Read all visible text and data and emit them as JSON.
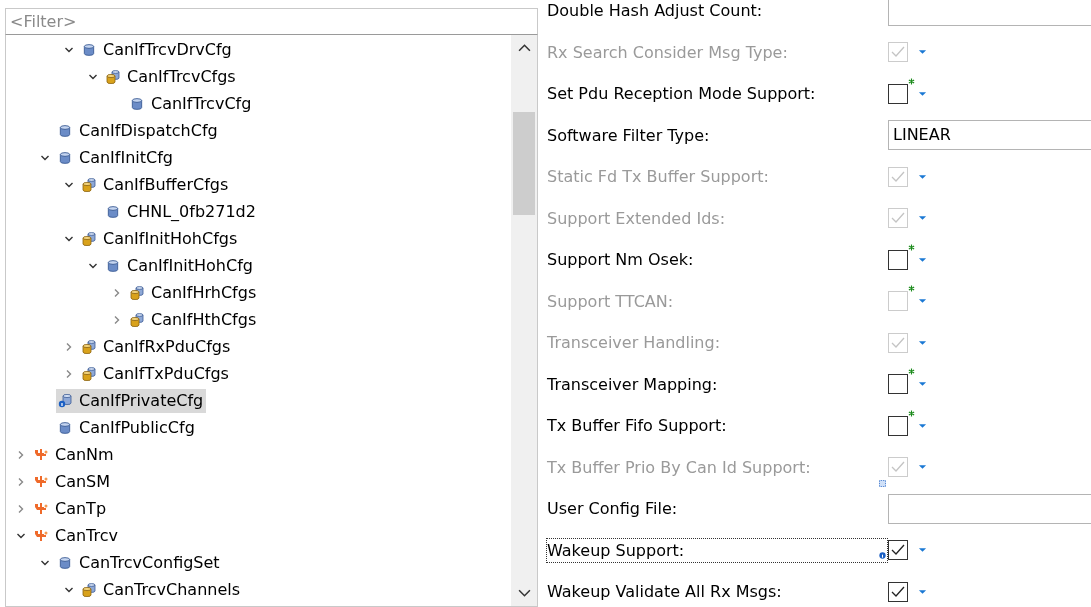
{
  "filter": {
    "placeholder": "<Filter>"
  },
  "tree": [
    {
      "children": [
        {
          "children": [
            {
              "label": "CanIfTrcvDrvCfg",
              "kind": "element",
              "expanded": true,
              "selected": false,
              "children": [
                {
                  "label": "CanIfTrcvCfgs",
                  "kind": "container",
                  "expanded": true,
                  "selected": false,
                  "children": [
                    {
                      "label": "CanIfTrcvCfg",
                      "kind": "element",
                      "selected": false
                    }
                  ]
                }
              ]
            }
          ]
        },
        {
          "label": "CanIfDispatchCfg",
          "kind": "element",
          "selected": false
        },
        {
          "label": "CanIfInitCfg",
          "kind": "element",
          "expanded": true,
          "selected": false,
          "children": [
            {
              "label": "CanIfBufferCfgs",
              "kind": "container",
              "expanded": true,
              "selected": false,
              "children": [
                {
                  "label": "CHNL_0fb271d2",
                  "kind": "element",
                  "selected": false
                }
              ]
            },
            {
              "label": "CanIfInitHohCfgs",
              "kind": "container",
              "expanded": true,
              "selected": false,
              "children": [
                {
                  "label": "CanIfInitHohCfg",
                  "kind": "element",
                  "expanded": true,
                  "selected": false,
                  "children": [
                    {
                      "label": "CanIfHrhCfgs",
                      "kind": "container",
                      "expanded": false,
                      "selected": false
                    },
                    {
                      "label": "CanIfHthCfgs",
                      "kind": "container",
                      "expanded": false,
                      "selected": false
                    }
                  ]
                }
              ]
            },
            {
              "label": "CanIfRxPduCfgs",
              "kind": "container",
              "expanded": false,
              "selected": false
            },
            {
              "label": "CanIfTxPduCfgs",
              "kind": "container",
              "expanded": false,
              "selected": false
            }
          ]
        },
        {
          "label": "CanIfPrivateCfg",
          "kind": "private",
          "selected": true
        },
        {
          "label": "CanIfPublicCfg",
          "kind": "element",
          "selected": false
        }
      ]
    },
    {
      "label": "CanNm",
      "kind": "module",
      "expanded": false,
      "selected": false
    },
    {
      "label": "CanSM",
      "kind": "module",
      "expanded": false,
      "selected": false
    },
    {
      "label": "CanTp",
      "kind": "module",
      "expanded": false,
      "selected": false
    },
    {
      "label": "CanTrcv",
      "kind": "module",
      "expanded": true,
      "selected": false,
      "children": [
        {
          "label": "CanTrcvConfigSet",
          "kind": "element",
          "expanded": true,
          "selected": false,
          "children": [
            {
              "label": "CanTrcvChannels",
              "kind": "container",
              "expanded": true,
              "selected": false
            }
          ]
        }
      ]
    }
  ],
  "properties": [
    {
      "label": "Double Hash Adjust Count:",
      "kind": "text",
      "disabled": false
    },
    {
      "label": "Rx Search Consider Msg Type:",
      "kind": "checkbox",
      "checked": true,
      "disabled": true,
      "modified": false
    },
    {
      "label": "Set Pdu Reception Mode Support:",
      "kind": "checkbox",
      "checked": false,
      "disabled": false,
      "modified": true
    },
    {
      "label": "Software Filter Type:",
      "kind": "text",
      "value": "LINEAR",
      "disabled": false
    },
    {
      "label": "Static Fd Tx Buffer Support:",
      "kind": "checkbox",
      "checked": true,
      "disabled": true,
      "modified": false
    },
    {
      "label": "Support Extended Ids:",
      "kind": "checkbox",
      "checked": true,
      "disabled": true,
      "modified": false
    },
    {
      "label": "Support Nm Osek:",
      "kind": "checkbox",
      "checked": false,
      "disabled": false,
      "modified": true
    },
    {
      "label": "Support TTCAN:",
      "kind": "checkbox",
      "checked": false,
      "disabled": true,
      "modified": true
    },
    {
      "label": "Transceiver Handling:",
      "kind": "checkbox",
      "checked": true,
      "disabled": true,
      "modified": false
    },
    {
      "label": "Transceiver Mapping:",
      "kind": "checkbox",
      "checked": false,
      "disabled": false,
      "modified": true
    },
    {
      "label": "Tx Buffer Fifo Support:",
      "kind": "checkbox",
      "checked": false,
      "disabled": false,
      "modified": true
    },
    {
      "label": "Tx Buffer Prio By Can Id Support:",
      "kind": "checkbox",
      "checked": true,
      "disabled": true,
      "modified": false
    },
    {
      "label": "User Config File:",
      "kind": "text",
      "disabled": false,
      "linked": true
    },
    {
      "label": "Wakeup Support:",
      "kind": "checkbox",
      "checked": true,
      "disabled": false,
      "modified": false,
      "focused": true,
      "info": true
    },
    {
      "label": "Wakeup Validate All Rx Msgs:",
      "kind": "checkbox",
      "checked": true,
      "disabled": false,
      "modified": false
    }
  ]
}
